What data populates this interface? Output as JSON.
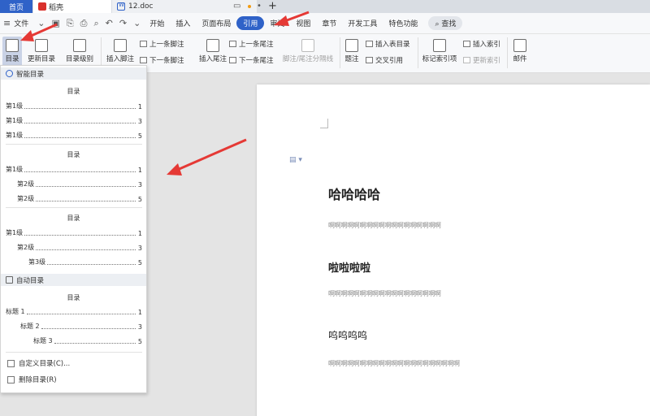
{
  "tabs": {
    "home": "首页",
    "daoke": "稻壳",
    "doc": "12.doc"
  },
  "menu": {
    "file": "文件",
    "items": [
      "开始",
      "插入",
      "页面布局",
      "引用",
      "审阅",
      "视图",
      "章节",
      "开发工具",
      "特色功能"
    ],
    "search": "查找"
  },
  "ribbon": {
    "toc": "目录",
    "update_toc": "更新目录",
    "toc_level": "目录级别",
    "insert_footnote": "插入脚注",
    "prev_footnote": "上一条脚注",
    "next_footnote": "下一条脚注",
    "insert_endnote": "插入尾注",
    "prev_endnote": "上一条尾注",
    "next_endnote": "下一条尾注",
    "note_separator": "脚注/尾注分隔线",
    "caption": "题注",
    "insert_figure_table": "插入表目录",
    "cross_reference": "交叉引用",
    "mark_index": "标记索引项",
    "insert_index": "插入索引",
    "update_index": "更新索引",
    "mail": "邮件"
  },
  "dropdown": {
    "smart_toc": "智能目录",
    "groups": [
      {
        "title": "目录",
        "entries": [
          {
            "label": "第1级",
            "page": "1"
          },
          {
            "label": "第1级",
            "page": "3"
          },
          {
            "label": "第1级",
            "page": "5"
          }
        ]
      },
      {
        "title": "目录",
        "entries": [
          {
            "label": "第1级",
            "page": "1"
          },
          {
            "label": "第2级",
            "page": "3"
          },
          {
            "label": "第2级",
            "page": "5"
          }
        ]
      },
      {
        "title": "目录",
        "entries": [
          {
            "label": "第1级",
            "page": "1"
          },
          {
            "label": "第2级",
            "page": "3"
          },
          {
            "label": "第3级",
            "page": "5"
          }
        ]
      }
    ],
    "auto_toc": "自动目录",
    "auto_group": {
      "title": "目录",
      "entries": [
        {
          "label": "标题 1",
          "page": "1"
        },
        {
          "label": "标题 2",
          "page": "3"
        },
        {
          "label": "标题 3",
          "page": "5"
        }
      ]
    },
    "custom_toc": "自定义目录(C)...",
    "delete_toc": "删除目录(R)"
  },
  "document": {
    "heading1": "哈哈哈哈",
    "body1": "啊啊啊啊啊啊啊啊啊啊啊啊啊啊啊啊啊啊",
    "heading2": "啦啦啦啦",
    "body2": "啊啊啊啊啊啊啊啊啊啊啊啊啊啊啊啊啊啊",
    "heading3": "呜呜呜呜",
    "body3": "啊啊啊啊啊啊啊啊啊啊啊啊啊啊啊啊啊啊啊啊啊"
  },
  "colors": {
    "accent": "#2f62c8",
    "annotation": "#e53935"
  }
}
